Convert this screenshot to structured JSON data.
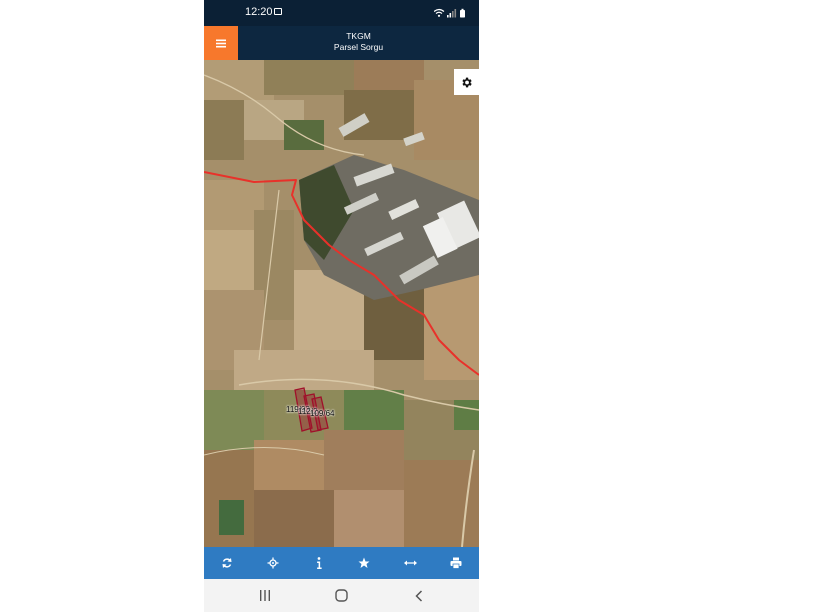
{
  "status_bar": {
    "time": "12:20",
    "icons": [
      "image-notification-icon",
      "wifi-icon",
      "signal-icon",
      "battery-icon"
    ]
  },
  "app_bar": {
    "title": "TKGM",
    "subtitle": "Parsel Sorgu",
    "menu_icon": "hamburger-menu-icon",
    "accent_color": "#f7782c",
    "background_color": "#0d2740"
  },
  "map": {
    "type": "satellite",
    "settings_icon": "gear-icon",
    "boundary_line_color": "#e8312a",
    "parcel_color": "#a0102a",
    "parcel_labels": [
      "119/93",
      "112/2",
      "109/64"
    ]
  },
  "toolbar": {
    "background_color": "#2f7bc2",
    "tools": [
      {
        "name": "refresh",
        "icon": "refresh-icon"
      },
      {
        "name": "locate",
        "icon": "crosshair-icon"
      },
      {
        "name": "info",
        "icon": "info-icon"
      },
      {
        "name": "favorites",
        "icon": "star-icon"
      },
      {
        "name": "measure",
        "icon": "measure-arrows-icon"
      },
      {
        "name": "print",
        "icon": "print-icon"
      }
    ]
  },
  "nav_bar": {
    "buttons": [
      "recent-apps-icon",
      "home-icon",
      "back-icon"
    ]
  }
}
